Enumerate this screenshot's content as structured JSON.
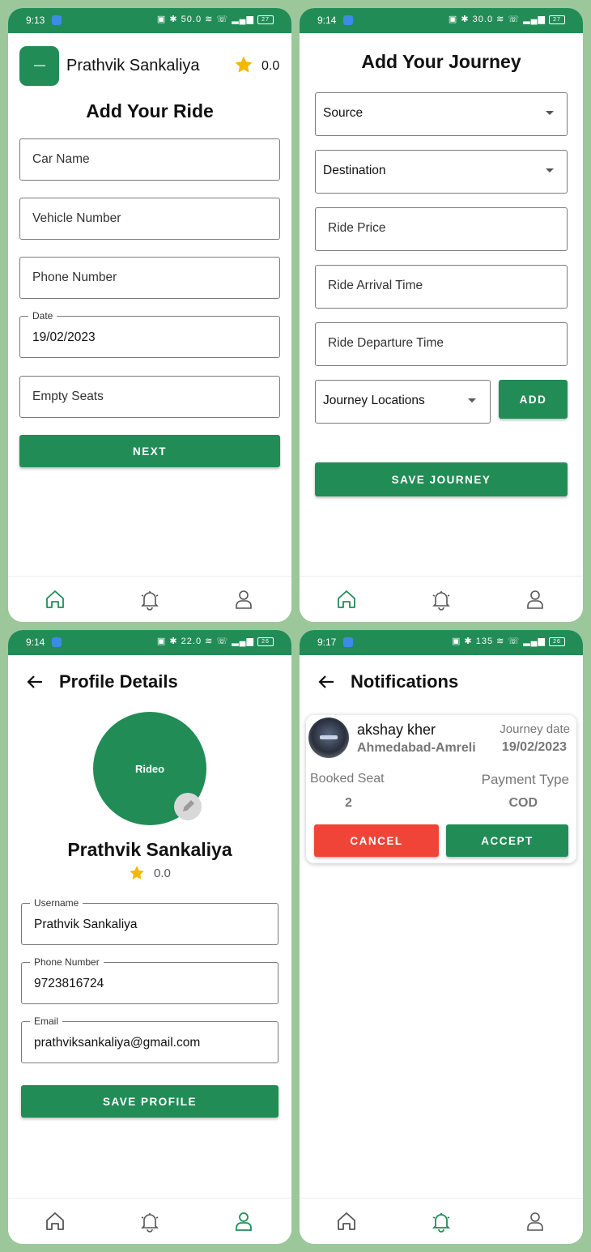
{
  "colors": {
    "primary": "#228c57",
    "danger": "#f04438",
    "background": "#9cc79b",
    "star": "#f5b800"
  },
  "screens": {
    "ride": {
      "status_time": "9:13",
      "status_net": "50.0",
      "battery": "27",
      "user_name": "Prathvik Sankaliya",
      "rating": "0.0",
      "title": "Add Your Ride",
      "fields": {
        "car_name": "Car Name",
        "vehicle_number": "Vehicle Number",
        "phone_number": "Phone Number",
        "date_label": "Date",
        "date_value": "19/02/2023",
        "empty_seats": "Empty Seats"
      },
      "next_label": "NEXT"
    },
    "journey": {
      "status_time": "9:14",
      "status_net": "30.0",
      "battery": "27",
      "title": "Add Your Journey",
      "source": "Source",
      "destination": "Destination",
      "ride_price": "Ride Price",
      "arrival_time": "Ride Arrival Time",
      "departure_time": "Ride Departure Time",
      "journey_locations": "Journey Locations",
      "add_label": "ADD",
      "save_label": "SAVE JOURNEY"
    },
    "profile": {
      "status_time": "9:14",
      "status_net": "22.0",
      "battery": "26",
      "title": "Profile Details",
      "avatar_text": "Rideo",
      "name": "Prathvik Sankaliya",
      "rating": "0.0",
      "username_label": "Username",
      "username_value": "Prathvik Sankaliya",
      "phone_label": "Phone Number",
      "phone_value": "9723816724",
      "email_label": "Email",
      "email_value": "prathviksankaliya@gmail.com",
      "save_label": "SAVE PROFILE"
    },
    "notifications": {
      "status_time": "9:17",
      "status_net": "135",
      "battery": "26",
      "title": "Notifications",
      "card": {
        "name": "akshay kher",
        "route": "Ahmedabad-Amreli",
        "journey_date_label": "Journey date",
        "journey_date": "19/02/2023",
        "booked_seat_label": "Booked Seat",
        "booked_seat": "2",
        "payment_type_label": "Payment Type",
        "payment_type": "COD",
        "cancel_label": "CANCEL",
        "accept_label": "ACCEPT"
      }
    }
  },
  "nav": {
    "items": [
      "home-icon",
      "bell-icon",
      "user-icon"
    ]
  }
}
